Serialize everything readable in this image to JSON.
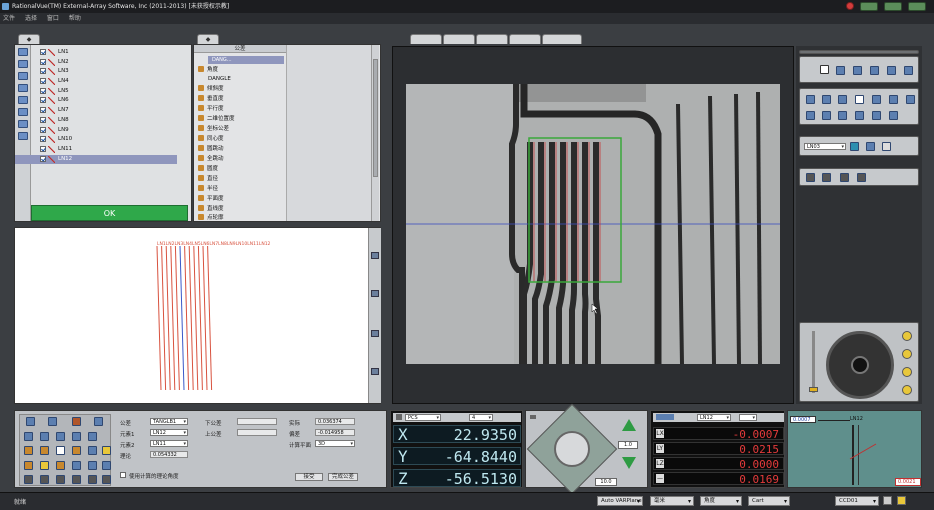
{
  "window": {
    "title": "RationalVue(TM) External-Array Software, Inc (2011-2013) [未获授权示教]"
  },
  "menu": [
    "文件",
    "选择",
    "窗口",
    "帮助"
  ],
  "element_list": {
    "items": [
      "LN1",
      "LN2",
      "LN3",
      "LN4",
      "LN5",
      "LN6",
      "LN7",
      "LN8",
      "LN9",
      "LN10",
      "LN11",
      "LN12"
    ],
    "selected": "LN12",
    "ok_label": "OK"
  },
  "tolerance_tree": {
    "header": "公差",
    "selected_item": "DANG...",
    "items": [
      "角度",
      "DANGLE",
      "倾斜度",
      "垂直度",
      "平行度",
      "二维位置度",
      "坐标公差",
      "同心度",
      "圆跳动",
      "全跳动",
      "圆度",
      "直径",
      "半径",
      "平面度",
      "直线度",
      "点轮廓"
    ]
  },
  "plot": {
    "label": "LN1LN2LN3LN4LN5LN6LN7LN8LN9LN10LN11LN12",
    "colors": {
      "lines": "#d8523f",
      "selected": "#3a58c8"
    }
  },
  "bottom_form": {
    "tolerance_label": "公差",
    "tolerance_value": "TANGLB1",
    "element1_label": "元素1",
    "element1_value": "LN12",
    "element2_label": "元素2",
    "element2_value": "LN11",
    "nominal_label": "理论",
    "nominal_value": "0.054332",
    "lower_label": "下公差",
    "upper_label": "上公差",
    "actual_label": "实际",
    "actual_value": "0.036374",
    "deviation_label": "偏差",
    "deviation_value": "-0.014958",
    "plane_label": "计算平面",
    "plane_value": "3D",
    "checkbox_label": "使用计算的理论角度",
    "apply_label": "接受",
    "complete_label": "完成公差"
  },
  "coords": {
    "frame": "PCS",
    "step": "4",
    "x_label": "X",
    "x_value": "22.9350",
    "y_label": "Y",
    "y_value": "-64.8440",
    "z_label": "Z",
    "z_value": "-56.5130"
  },
  "joystick": {
    "speed_value": "10.0",
    "step_value": "1.0"
  },
  "deltas": {
    "element": "LN12",
    "dx_label": "LX",
    "dx_value": "-0.0007",
    "dy_label": "LY",
    "dy_value": "0.0215",
    "dz_label": "LZ",
    "dz_value": "0.0000",
    "d_label": "—",
    "d_value": "0.0169"
  },
  "mini_view": {
    "left_value": "0.0007",
    "element": "LN12",
    "right_value": "0.0021"
  },
  "right_panel": {
    "element_field": "LN03"
  },
  "status": {
    "text": "就绪",
    "mode": "Auto VARPlane",
    "units": "毫米",
    "angle": "角度",
    "coord_sys": "Cart",
    "camera": "CCD01"
  },
  "colors": {
    "ok_green": "#2fa84a",
    "readout_red": "#e43b3b",
    "readout_cyan": "#bfe8f0",
    "selection": "#8f96bd"
  }
}
